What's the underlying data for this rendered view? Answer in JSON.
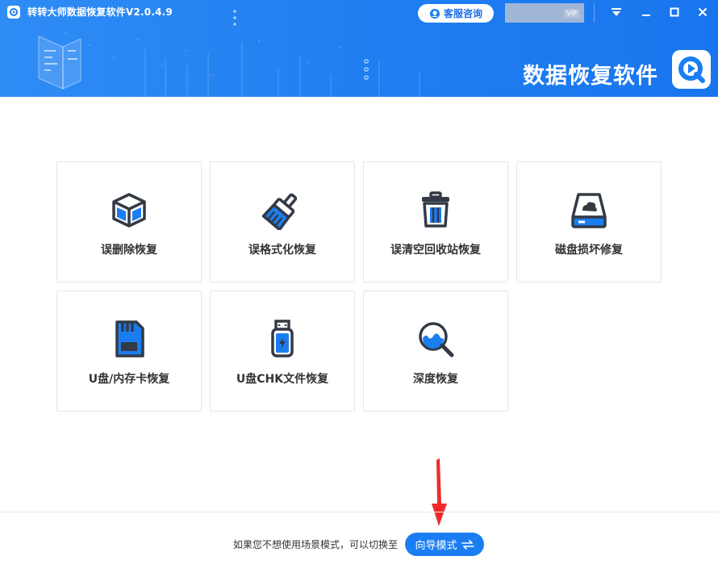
{
  "window": {
    "title": "转转大师数据恢复软件V2.0.4.9",
    "service_label": "客服咨询",
    "vip_badge": "VIP"
  },
  "banner": {
    "brand_text": "数据恢复软件"
  },
  "cards": [
    {
      "label": "误删除恢复",
      "icon": "cube-icon"
    },
    {
      "label": "误格式化恢复",
      "icon": "broom-icon"
    },
    {
      "label": "误清空回收站恢复",
      "icon": "trash-bin-icon"
    },
    {
      "label": "磁盘损坏修复",
      "icon": "hard-disk-icon"
    },
    {
      "label": "U盘/内存卡恢复",
      "icon": "sd-card-icon"
    },
    {
      "label": "U盘CHK文件恢复",
      "icon": "usb-drive-icon"
    },
    {
      "label": "深度恢复",
      "icon": "magnifier-icon"
    }
  ],
  "footer": {
    "hint": "如果您不想使用场景模式，可以切换至",
    "guide_label": "向导模式"
  },
  "colors": {
    "accent": "#1a7ef2",
    "header": "#2483f2",
    "icon_dark": "#333a45",
    "arrow": "#ee2b2b"
  }
}
